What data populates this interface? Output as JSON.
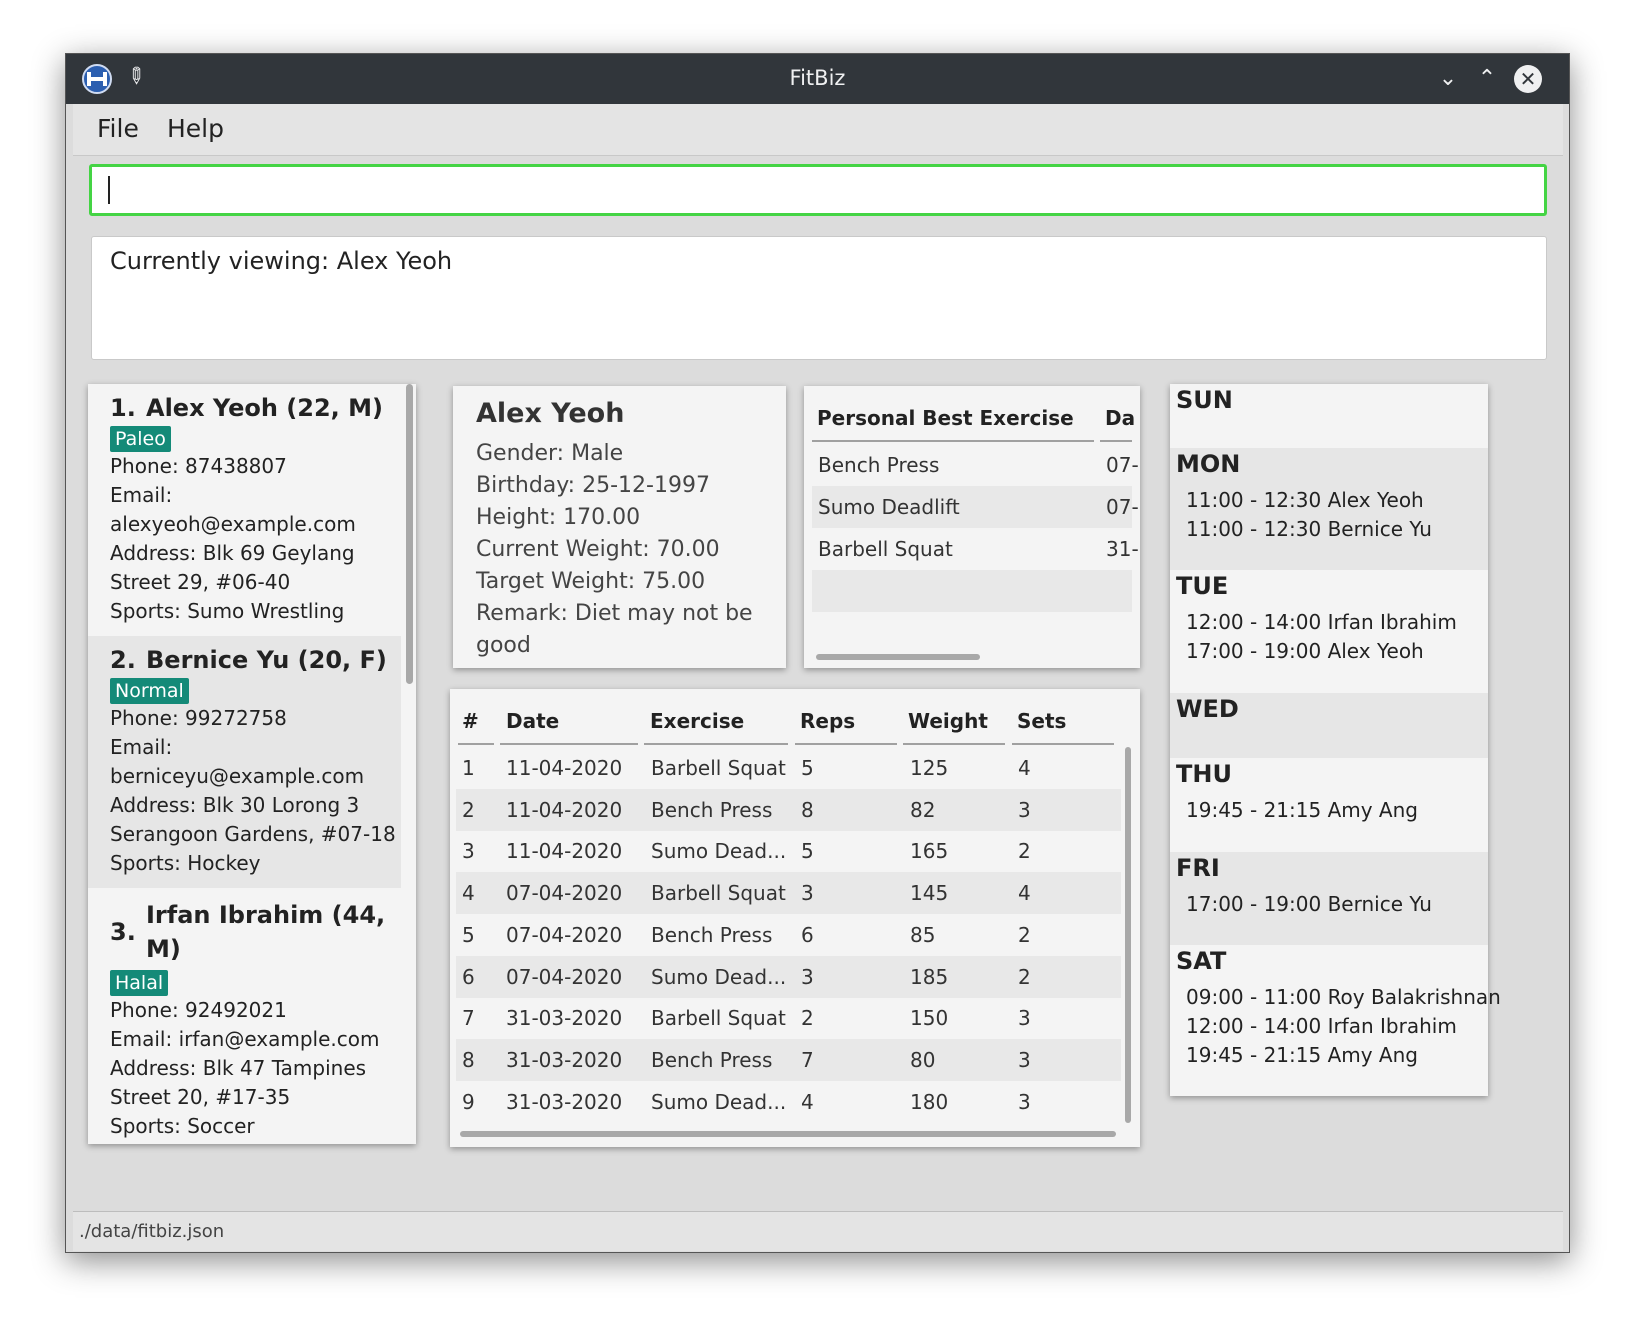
{
  "window": {
    "title": "FitBiz"
  },
  "menu": {
    "file": "File",
    "help": "Help"
  },
  "command_box": {
    "value": ""
  },
  "result": {
    "text": "Currently viewing: Alex Yeoh"
  },
  "clients": [
    {
      "index": "1.",
      "name": "Alex Yeoh (22, M)",
      "tag": "Paleo",
      "lines": [
        "Phone: 87438807",
        "Email:",
        "alexyeoh@example.com",
        "Address: Blk 69 Geylang",
        "Street 29, #06-40",
        "Sports: Sumo Wrestling"
      ]
    },
    {
      "index": "2.",
      "name": "Bernice Yu (20, F)",
      "tag": "Normal",
      "lines": [
        "Phone: 99272758",
        "Email:",
        "berniceyu@example.com",
        "Address: Blk 30 Lorong 3",
        "Serangoon Gardens, #07-18",
        "Sports: Hockey"
      ]
    },
    {
      "index": "3.",
      "name_line1": "Irfan Ibrahim (44,",
      "name_line2": "M)",
      "tag": "Halal",
      "lines": [
        "Phone: 92492021",
        "Email: irfan@example.com",
        "Address: Blk 47 Tampines",
        "Street 20, #17-35",
        "Sports: Soccer"
      ]
    }
  ],
  "profile": {
    "name": "Alex Yeoh",
    "lines": [
      "Gender: Male",
      "Birthday: 25-12-1997",
      "Height: 170.00",
      "Current Weight: 70.00",
      "Target Weight: 75.00",
      "Remark: Diet may not be",
      "good"
    ]
  },
  "personal_best": {
    "headers": [
      "Personal Best Exercise",
      "Da"
    ],
    "rows": [
      [
        "Bench Press",
        "07-"
      ],
      [
        "Sumo Deadlift",
        "07-"
      ],
      [
        "Barbell Squat",
        "31-"
      ]
    ]
  },
  "history": {
    "headers": [
      "#",
      "Date",
      "Exercise",
      "Reps",
      "Weight",
      "Sets"
    ],
    "rows": [
      [
        "1",
        "11-04-2020",
        "Barbell Squat",
        "5",
        "125",
        "4"
      ],
      [
        "2",
        "11-04-2020",
        "Bench Press",
        "8",
        "82",
        "3"
      ],
      [
        "3",
        "11-04-2020",
        "Sumo Dead...",
        "5",
        "165",
        "2"
      ],
      [
        "4",
        "07-04-2020",
        "Barbell Squat",
        "3",
        "145",
        "4"
      ],
      [
        "5",
        "07-04-2020",
        "Bench Press",
        "6",
        "85",
        "2"
      ],
      [
        "6",
        "07-04-2020",
        "Sumo Dead...",
        "3",
        "185",
        "2"
      ],
      [
        "7",
        "31-03-2020",
        "Barbell Squat",
        "2",
        "150",
        "3"
      ],
      [
        "8",
        "31-03-2020",
        "Bench Press",
        "7",
        "80",
        "3"
      ],
      [
        "9",
        "31-03-2020",
        "Sumo Dead...",
        "4",
        "180",
        "3"
      ]
    ]
  },
  "schedule": [
    {
      "day": "SUN",
      "slots": []
    },
    {
      "day": "MON",
      "slots": [
        "11:00 - 12:30 Alex Yeoh",
        "11:00 - 12:30 Bernice Yu"
      ]
    },
    {
      "day": "TUE",
      "slots": [
        "12:00 - 14:00 Irfan Ibrahim",
        "17:00 - 19:00 Alex Yeoh"
      ]
    },
    {
      "day": "WED",
      "slots": []
    },
    {
      "day": "THU",
      "slots": [
        "19:45 - 21:15 Amy Ang"
      ]
    },
    {
      "day": "FRI",
      "slots": [
        "17:00 - 19:00 Bernice Yu"
      ]
    },
    {
      "day": "SAT",
      "slots": [
        "09:00 - 11:00 Roy Balakrishnan",
        "12:00 - 14:00 Irfan Ibrahim",
        "19:45 - 21:15 Amy Ang"
      ]
    }
  ],
  "status": {
    "file_path": "./data/fitbiz.json"
  },
  "colors": {
    "accent_green": "#44d444",
    "tag_teal": "#148a78",
    "titlebar": "#31363b"
  }
}
